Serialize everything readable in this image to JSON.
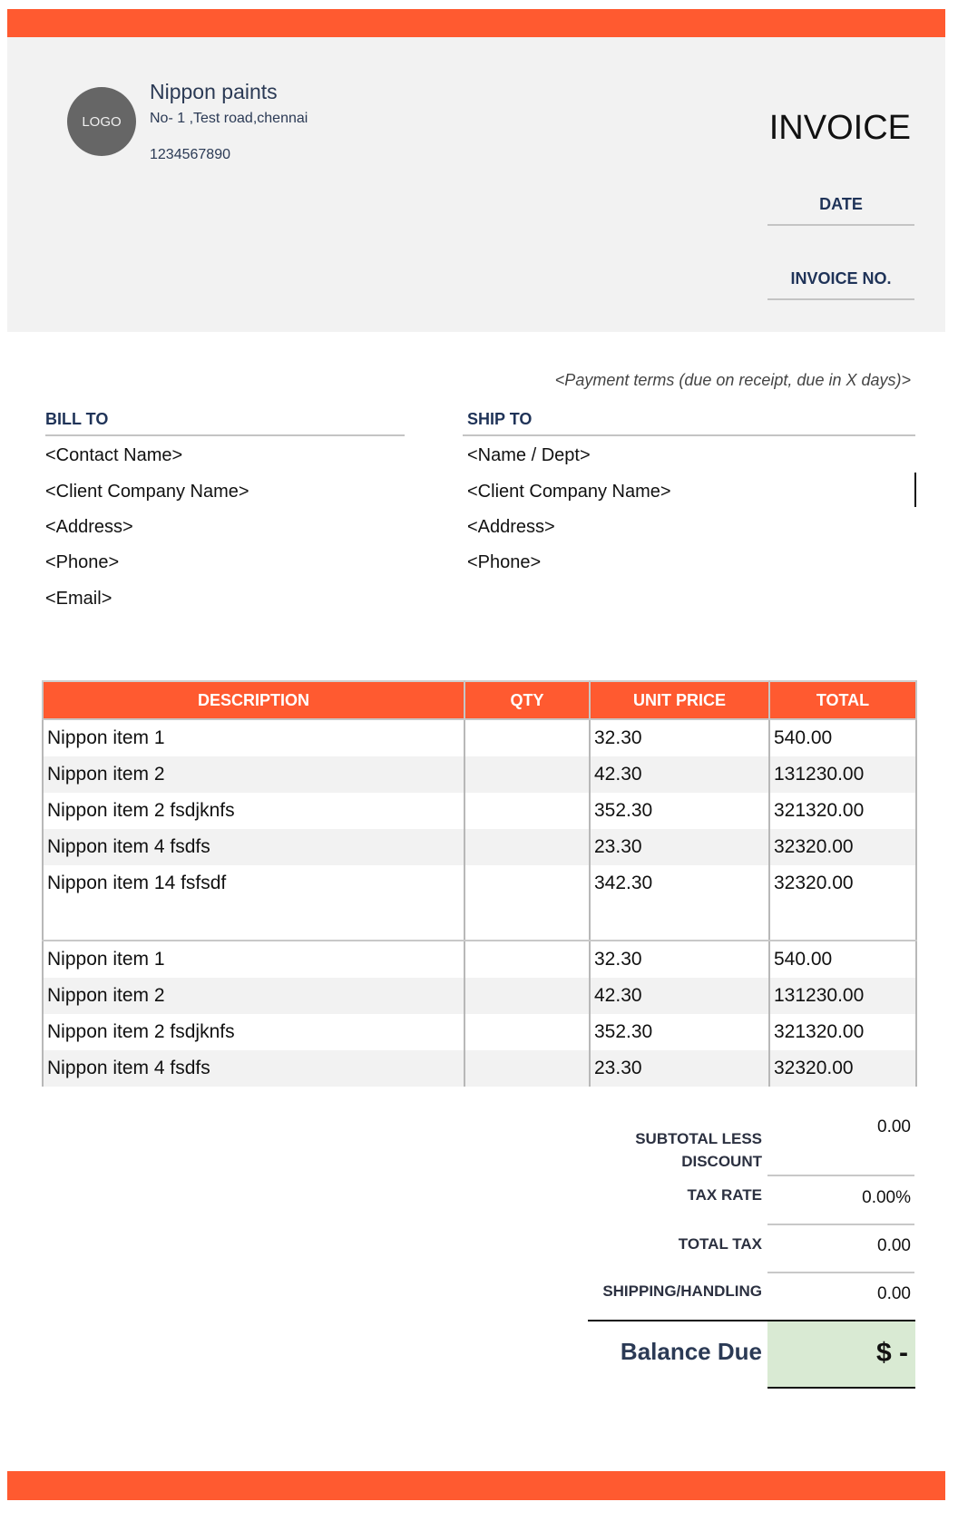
{
  "company": {
    "logo_text": "LOGO",
    "name": "Nippon paints",
    "address": "No- 1 ,Test road,chennai",
    "phone": "1234567890"
  },
  "invoice": {
    "title": "INVOICE",
    "date_label": "DATE",
    "number_label": "INVOICE NO.",
    "payment_terms": "<Payment terms (due on receipt, due in X days)>"
  },
  "bill_to": {
    "title": "BILL TO",
    "lines": [
      "<Contact Name>",
      "<Client Company Name>",
      "<Address>",
      "<Phone>",
      "<Email>"
    ]
  },
  "ship_to": {
    "title": "SHIP TO",
    "lines": [
      "<Name / Dept>",
      "<Client Company Name>",
      "<Address>",
      "<Phone>"
    ]
  },
  "table": {
    "headers": [
      "DESCRIPTION",
      "QTY",
      "UNIT PRICE",
      "TOTAL"
    ],
    "rows": [
      {
        "description": "Nippon item 1",
        "qty": "",
        "unit_price": "32.30",
        "total": "540.00"
      },
      {
        "description": "Nippon item 2",
        "qty": "",
        "unit_price": "42.30",
        "total": "131230.00"
      },
      {
        "description": "Nippon item 2 fsdjknfs",
        "qty": "",
        "unit_price": "352.30",
        "total": "321320.00"
      },
      {
        "description": "Nippon item 4 fsdfs",
        "qty": "",
        "unit_price": "23.30",
        "total": "32320.00"
      },
      {
        "description": "Nippon item 14 fsfsdf",
        "qty": "",
        "unit_price": "342.30",
        "total": "32320.00"
      },
      {
        "description": "",
        "qty": "",
        "unit_price": "",
        "total": ""
      },
      {
        "description": "Nippon item 1",
        "qty": "",
        "unit_price": "32.30",
        "total": "540.00"
      },
      {
        "description": "Nippon item 2",
        "qty": "",
        "unit_price": "42.30",
        "total": "131230.00"
      },
      {
        "description": "Nippon item 2 fsdjknfs",
        "qty": "",
        "unit_price": "352.30",
        "total": "321320.00"
      },
      {
        "description": "Nippon item 4 fsdfs",
        "qty": "",
        "unit_price": "23.30",
        "total": "32320.00"
      }
    ]
  },
  "totals": {
    "subtotal_label_line1": "SUBTOTAL LESS",
    "subtotal_label_line2": "DISCOUNT",
    "subtotal_value": "0.00",
    "tax_rate_label": "TAX RATE",
    "tax_rate_value": "0.00%",
    "total_tax_label": "TOTAL TAX",
    "total_tax_value": "0.00",
    "shipping_label": "SHIPPING/HANDLING",
    "shipping_value": "0.00",
    "balance_label": "Balance Due",
    "balance_value": "$ -"
  },
  "colors": {
    "accent": "#ff5a30",
    "header_bg": "#f2f2f2",
    "navy_text": "#1f3358",
    "balance_bg": "#d9ead3"
  }
}
